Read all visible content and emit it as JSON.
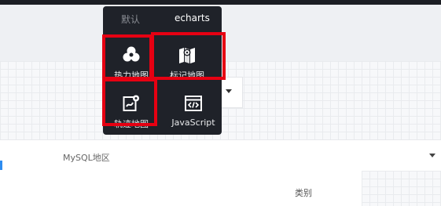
{
  "popup": {
    "tabs": [
      {
        "label": "默认",
        "active": false
      },
      {
        "label": "echarts",
        "active": true
      }
    ],
    "items": [
      {
        "label": "热力地图",
        "icon": "heatmap-icon"
      },
      {
        "label": "标记地图",
        "icon": "map-marker-icon"
      },
      {
        "label": "轨迹地图",
        "icon": "trajectory-icon"
      },
      {
        "label": "JavaScript",
        "icon": "code-icon"
      }
    ],
    "highlight_color": "#e60012"
  },
  "form": {
    "field_label": "MySQL地区",
    "column_label": "类别"
  },
  "colors": {
    "popup_bg": "#1f2229",
    "accent": "#2d8cf0"
  }
}
